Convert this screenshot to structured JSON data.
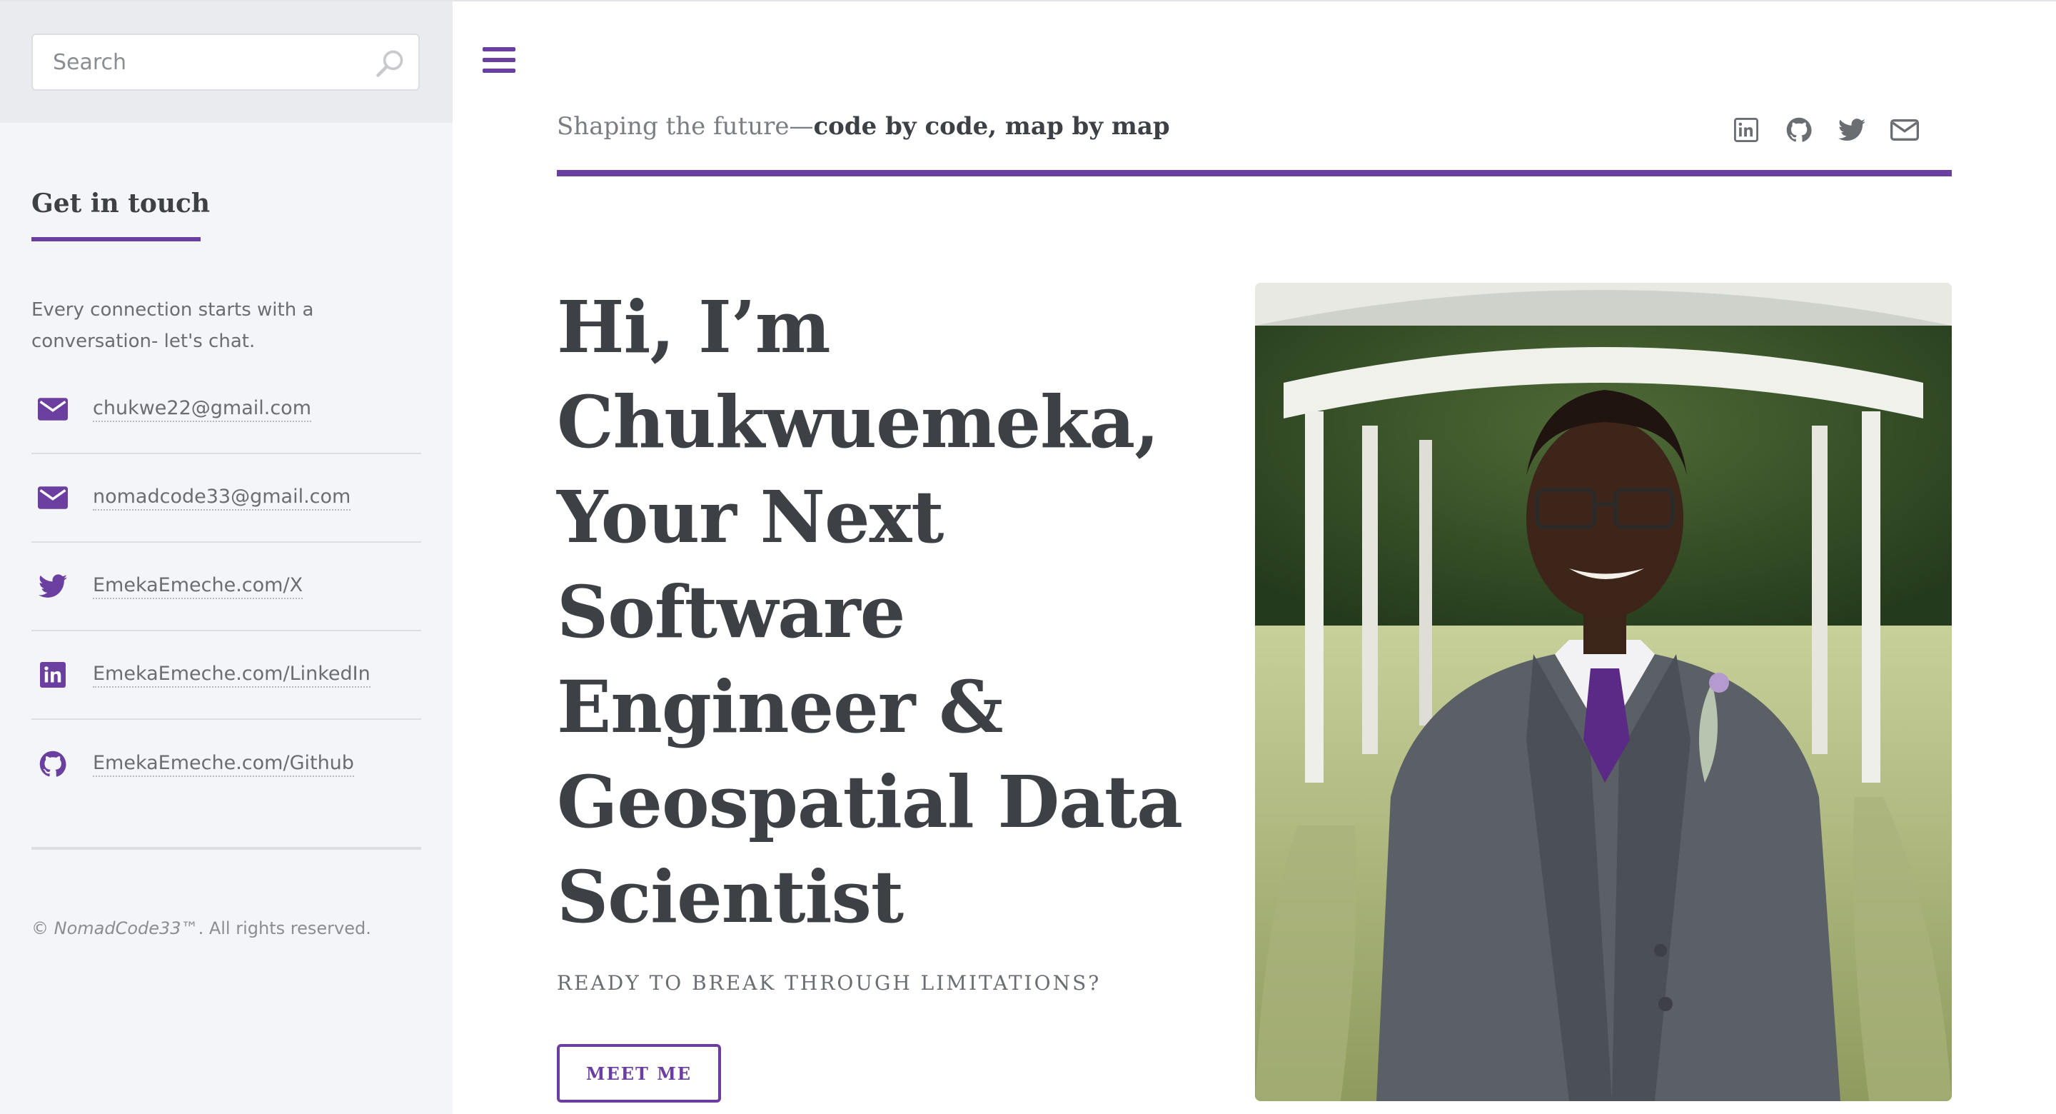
{
  "sidebar": {
    "search": {
      "placeholder": "Search"
    },
    "title": "Get in touch",
    "intro": "Every connection starts with a conversation- let's chat.",
    "contacts": [
      {
        "icon": "mail-icon",
        "label": "chukwe22@gmail.com"
      },
      {
        "icon": "mail-icon",
        "label": "nomadcode33@gmail.com"
      },
      {
        "icon": "twitter-icon",
        "label": "EmekaEmeche.com/X"
      },
      {
        "icon": "linkedin-icon",
        "label": "EmekaEmeche.com/LinkedIn"
      },
      {
        "icon": "github-icon",
        "label": "EmekaEmeche.com/Github"
      }
    ],
    "copyright": {
      "prefix": "© ",
      "brand": "NomadCode33",
      "suffix": "™. All rights reserved."
    }
  },
  "header": {
    "tagline_light": "Shaping the future—",
    "tagline_bold": "code by code, map by map",
    "social_icons": [
      "linkedin-icon",
      "github-icon",
      "twitter-icon",
      "mail-icon"
    ]
  },
  "hero": {
    "title_lines": [
      "Hi, I’m",
      "Chukwuemeka,",
      "Your Next",
      "Software",
      "Engineer &",
      "Geospatial Data",
      "Scientist"
    ],
    "subtitle": "READY TO BREAK THROUGH LIMITATIONS?",
    "button_label": "MEET ME"
  },
  "colors": {
    "accent": "#6b3fa0",
    "text": "#3d4145",
    "muted": "#6a6d72",
    "sidebar_bg": "#f4f5f8"
  }
}
